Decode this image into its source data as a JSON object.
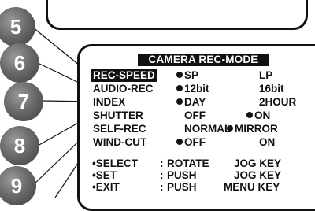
{
  "osd": {
    "title": "CAMERA REC-MODE",
    "rows": [
      {
        "label": "REC-SPEED",
        "options": [
          "SP",
          "LP"
        ],
        "selected": 0
      },
      {
        "label": "AUDIO-REC",
        "options": [
          "12bit",
          "16bit"
        ],
        "selected": 0
      },
      {
        "label": "INDEX",
        "options": [
          "DAY",
          "2HOUR"
        ],
        "selected": 0
      },
      {
        "label": "SHUTTER",
        "options": [
          "OFF",
          "ON"
        ],
        "selected": 1
      },
      {
        "label": "SELF-REC",
        "options": [
          "NORMAL",
          "MIRROR"
        ],
        "selected": 1
      },
      {
        "label": "WIND-CUT",
        "options": [
          "OFF",
          "ON"
        ],
        "selected": 0
      }
    ],
    "help": [
      {
        "key": "•SELECT",
        "colon": ":",
        "action": "ROTATE",
        "target": "JOG KEY"
      },
      {
        "key": "•SET",
        "colon": ":",
        "action": "PUSH",
        "target": "JOG KEY"
      },
      {
        "key": "•EXIT",
        "colon": ":",
        "action": "PUSH",
        "target": "MENU KEY"
      }
    ]
  },
  "callouts": [
    "5",
    "6",
    "7",
    "8",
    "9"
  ]
}
